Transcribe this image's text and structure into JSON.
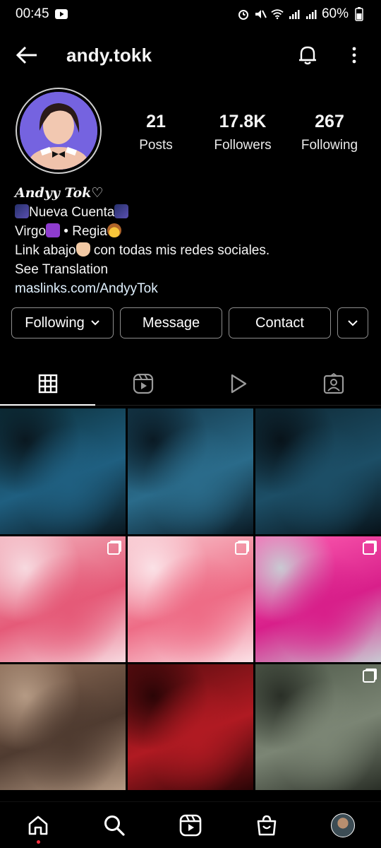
{
  "status_bar": {
    "time": "00:45",
    "battery": "60%"
  },
  "header": {
    "username": "andy.tokk"
  },
  "profile": {
    "stats": [
      {
        "value": "21",
        "label": "Posts"
      },
      {
        "value": "17.8K",
        "label": "Followers"
      },
      {
        "value": "267",
        "label": "Following"
      }
    ],
    "bio": {
      "name": "Andyy Tok♡",
      "line1": "Nueva Cuenta",
      "line2_a": "Virgo",
      "line2_b": " • Regia",
      "line3_a": "Link abajo",
      "line3_b": " con todas mis redes sociales.",
      "see_translation": "See Translation",
      "link": "maslinks.com/AndyyTok"
    }
  },
  "actions": {
    "following": "Following",
    "message": "Message",
    "contact": "Contact"
  },
  "tabs": [
    "grid-icon",
    "reels-icon",
    "play-icon",
    "tagged-icon"
  ],
  "grid": {
    "items": [
      {
        "colors": [
          "#0c2f3a",
          "#1f5f80",
          "#0a1820"
        ],
        "multi": false
      },
      {
        "colors": [
          "#14384a",
          "#2a6b8a",
          "#0a1a24"
        ],
        "multi": false
      },
      {
        "colors": [
          "#0f2a36",
          "#1c4e66",
          "#08131a"
        ],
        "multi": false
      },
      {
        "colors": [
          "#f2b0bb",
          "#e55a78",
          "#f7d9df"
        ],
        "multi": true
      },
      {
        "colors": [
          "#f8c4cc",
          "#ee6c86",
          "#fbe1e6"
        ],
        "multi": true
      },
      {
        "colors": [
          "#ff5fb2",
          "#d81f8a",
          "#c9c9d2"
        ],
        "multi": true
      },
      {
        "colors": [
          "#8a6a55",
          "#4f3b30",
          "#b59a84"
        ],
        "multi": false
      },
      {
        "colors": [
          "#5a0d10",
          "#b01a22",
          "#2b0506"
        ],
        "multi": false
      },
      {
        "colors": [
          "#4f5a4a",
          "#7b8574",
          "#2a2f27"
        ],
        "multi": true
      }
    ]
  },
  "bottom_nav": [
    "home-icon",
    "search-icon",
    "reels-icon",
    "shop-icon",
    "profile-avatar"
  ],
  "colors": {
    "background": "#000000",
    "text": "#f5f5f5",
    "border": "#8e8e8e",
    "accent_dot": "#ff3040"
  }
}
